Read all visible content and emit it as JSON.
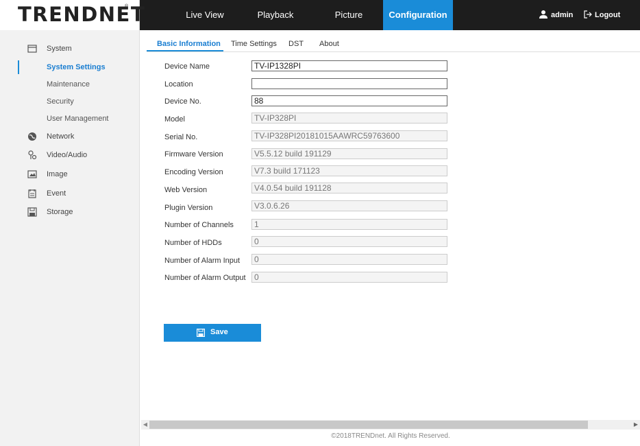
{
  "brand": {
    "logo_text": "TRENDNET",
    "reg_mark": "®"
  },
  "nav": {
    "items": [
      {
        "label": "Live View"
      },
      {
        "label": "Playback"
      },
      {
        "label": "Picture"
      },
      {
        "label": "Configuration",
        "active": true
      }
    ],
    "user": "admin",
    "logout": "Logout"
  },
  "sidebar": {
    "system": "System",
    "system_sub": [
      "System Settings",
      "Maintenance",
      "Security",
      "User Management"
    ],
    "active_sub": "System Settings",
    "network": "Network",
    "video_audio": "Video/Audio",
    "image": "Image",
    "event": "Event",
    "storage": "Storage",
    "icons": [
      "system-icon",
      "network-icon",
      "video-audio-icon",
      "image-icon",
      "event-icon",
      "storage-icon"
    ]
  },
  "tabs": [
    "Basic Information",
    "Time Settings",
    "DST",
    "About"
  ],
  "active_tab": "Basic Information",
  "form": {
    "fields": [
      {
        "label": "Device Name",
        "value": "TV-IP1328PI",
        "editable": true
      },
      {
        "label": "Location",
        "value": "",
        "editable": true
      },
      {
        "label": "Device No.",
        "value": "88",
        "editable": true
      },
      {
        "label": "Model",
        "value": "TV-IP328PI",
        "editable": false
      },
      {
        "label": "Serial No.",
        "value": "TV-IP328PI20181015AAWRC59763600",
        "editable": false
      },
      {
        "label": "Firmware Version",
        "value": "V5.5.12 build 191129",
        "editable": false
      },
      {
        "label": "Encoding Version",
        "value": "V7.3 build 171123",
        "editable": false
      },
      {
        "label": "Web Version",
        "value": "V4.0.54 build 191128",
        "editable": false
      },
      {
        "label": "Plugin Version",
        "value": "V3.0.6.26",
        "editable": false
      },
      {
        "label": "Number of Channels",
        "value": "1",
        "editable": false
      },
      {
        "label": "Number of HDDs",
        "value": "0",
        "editable": false
      },
      {
        "label": "Number of Alarm Input",
        "value": "0",
        "editable": false
      },
      {
        "label": "Number of Alarm Output",
        "value": "0",
        "editable": false
      }
    ],
    "save_label": "Save"
  },
  "footer": "©2018TRENDnet. All Rights Reserved.",
  "colors": {
    "accent": "#1a8cd8",
    "topbar": "#1d1d1d",
    "sidebar_bg": "#f2f2f2"
  }
}
